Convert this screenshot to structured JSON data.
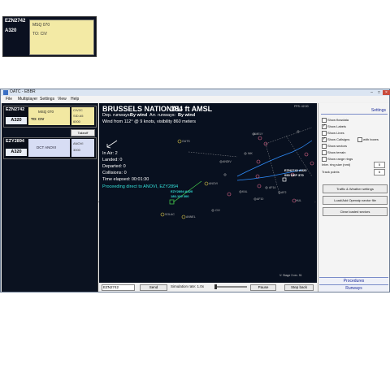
{
  "top_strip": {
    "callsign": "EZN2742",
    "type": "A320",
    "lines": [
      "MSQ 070",
      "TO: CIV"
    ]
  },
  "window": {
    "title": "OATC - EBBR",
    "menu": [
      "File",
      "Multiplayer",
      "Settings",
      "View",
      "Help"
    ]
  },
  "aircraft_list": [
    {
      "callsign": "EZN2742",
      "type": "A320",
      "box_lines": [
        "MSQ 070",
        "TO: CIV"
      ],
      "side_lines": [
        "CIV2C",
        "SID A5",
        "6000"
      ],
      "takeoff_label": "Takeoff"
    },
    {
      "callsign": "EZY2894",
      "type": "A320",
      "box_lines": [
        "DCT ANOVI"
      ],
      "side_lines": [
        "ANOVI",
        "3000"
      ]
    }
  ],
  "radar": {
    "airport_name": "BRUSSELS NATIONAL",
    "elevation": "184 ft AMSL",
    "dep_runways_label": "Dep. runways:",
    "dep_runways_value": "By wind",
    "arr_runways_label": "Arr. runways:",
    "arr_runways_value": "By wind",
    "wind_line": "Wind from 112° @ 9 knots, visibility 860 meters",
    "stats": {
      "in_air": "In Air: 2",
      "landed": "Landed: 0",
      "departed": "Departed: 0",
      "collisions": "Collisions: 0",
      "time": "Time elapsed: 00:01:30"
    },
    "message": "Proceeding direct to ANOVI, EZY2894",
    "fps": "FPS: 42.00",
    "stage": "V: Stage 3 rev. 91",
    "target1_lines": [
      "EZN2742 A320",
      "090 DEP 370"
    ],
    "target2_lines": [
      "EZY2894 A320",
      "180-100 300"
    ],
    "fixes": [
      "GUTS",
      "ANOVI",
      "CIV",
      "SOLAC",
      "ANNEL",
      "AMELY",
      "ANDIV",
      "NIK",
      "AF10",
      "AF14",
      "KAL",
      "HUL",
      "AF2"
    ],
    "colors": {
      "background": "#08101f",
      "message": "#33e0d8",
      "trail": "#2f8fff",
      "target": "#ffffff",
      "fix": "#b8b8b8"
    }
  },
  "bottom": {
    "callsign_input": "EZN2742",
    "send_label": "Send",
    "sim_rate_label": "Simulation rate: 1.0x",
    "pause_label": "Pause",
    "step_back_label": "Step back"
  },
  "settings": {
    "title": "Settings",
    "checkboxes": [
      {
        "label": "Show flowdata",
        "checked": false
      },
      {
        "label": "Show Labels",
        "checked": true
      },
      {
        "label": "Show Lines",
        "checked": false
      },
      {
        "label": "Show Callsigns",
        "checked": true
      },
      {
        "label": "Show sectors",
        "checked": false
      },
      {
        "label": "Show terrain",
        "checked": false
      },
      {
        "label": "Show range rings",
        "checked": false
      }
    ],
    "with_boxes_label": "with boxes",
    "ring_size_label": "Inter. ring size (nmi)",
    "ring_size_value": "5",
    "track_points_label": "Track points",
    "track_points_value": "5",
    "buttons": [
      "Traffic & Weather settings",
      "Load/Add Openaip sector file",
      "Clear loaded sectors"
    ],
    "footer": [
      "Procedures",
      "Runways"
    ]
  }
}
